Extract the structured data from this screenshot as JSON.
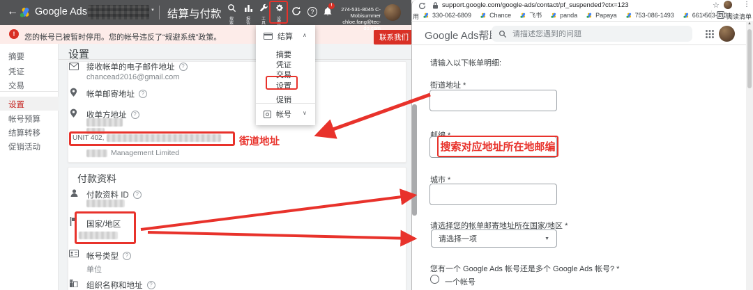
{
  "colors": {
    "annotation_red": "#e8322b",
    "google_red": "#d93025",
    "toolbar_gray": "#535456",
    "alert_pink": "#fdece9",
    "selected_red": "#c5221f",
    "logo_blue": "#4285f4",
    "logo_yellow": "#fbbc04",
    "logo_green": "#34a853"
  },
  "left_window": {
    "toolbar": {
      "back_glyph": "←",
      "brand": "Google Ads",
      "section_title": "结算与付款",
      "nav_icons": [
        {
          "name": "search",
          "label": "搜索"
        },
        {
          "name": "reports",
          "label": "报告"
        },
        {
          "name": "tools",
          "label": "工具"
        },
        {
          "name": "settings",
          "label": "设置"
        }
      ],
      "notification_badge": "!",
      "account_id": "274-531-8045 C-Mobisummer",
      "account_email": "chloe.fang@tec-do.com"
    },
    "alert_bar": {
      "badge": "!",
      "text": "您的帐号已被暂时停用。您的帐号违反了“规避系统”政策。",
      "contact_button": "联系我们",
      "more_glyph": "⋮"
    },
    "sidebar": {
      "items": [
        {
          "label": "摘要"
        },
        {
          "label": "凭证"
        },
        {
          "label": "交易"
        },
        {
          "label": "设置"
        },
        {
          "label": "帐号预算"
        },
        {
          "label": "结算转移"
        },
        {
          "label": "促销活动"
        }
      ]
    },
    "dropdown_menu": {
      "group1": "结算",
      "items": [
        "摘要",
        "凭证",
        "交易",
        "设置",
        "促销"
      ],
      "group2": "帐号",
      "collapse_glyph": "∧",
      "expand_glyph": "∨"
    },
    "content": {
      "page_title": "设置",
      "billing_card": {
        "email_label": "接收帐单的电子邮件地址",
        "email_value": "chancead2016@gmail.com",
        "mailing_address_label": "帐单邮寄地址",
        "bill_to_label": "收单方地址",
        "street_value": "UNIT 402,",
        "company_suffix": "Management Limited"
      },
      "payment_card": {
        "title": "付款资料",
        "profile_id_label": "付款资料 ID",
        "country_label": "国家/地区",
        "account_type_label": "帐号类型",
        "account_type_value": "单位",
        "org_label": "组织名称和地址"
      }
    },
    "annotations": {
      "street_label": "街道地址"
    }
  },
  "right_window": {
    "browser": {
      "url": "support.google.com/google-ads/contact/pf_suspended?ctx=123",
      "star_glyph": "☆",
      "more_glyph": "⋮",
      "bookmarks_prefix": "用",
      "bookmarks": [
        "330-062-6809",
        "Chance",
        "飞书",
        "panda",
        "Papaya",
        "753-086-1493",
        "661-563-7131"
      ],
      "overflow_glyph": "»",
      "reading_list": "阅读清单"
    },
    "help_header": {
      "title": "Google Ads帮助",
      "search_placeholder": "请描述您遇到的问题"
    },
    "form": {
      "intro": "请输入以下帐单明细:",
      "street_label": "街道地址 *",
      "zip_label": "邮编 *",
      "zip_annotation": "搜索对应地址所在地邮编",
      "city_label": "城市 *",
      "country_label": "请选择您的帐单邮寄地址所在国家/地区 *",
      "country_placeholder": "请选择一项",
      "accounts_question": "您有一个 Google Ads 帐号还是多个 Google Ads 帐号? *",
      "radio_one_account": "一个帐号"
    }
  }
}
